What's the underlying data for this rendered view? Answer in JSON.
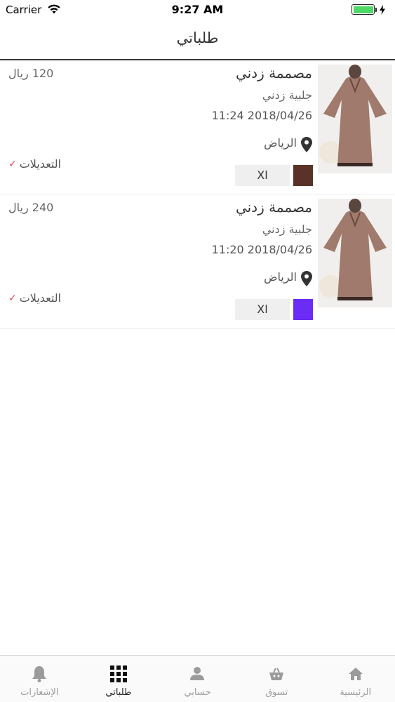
{
  "status_bar": {
    "carrier": "Carrier",
    "time": "9:27 AM",
    "battery_color": "#4cd964"
  },
  "nav": {
    "title": "طلباتي"
  },
  "orders": [
    {
      "name": "مصممة زدني",
      "type": "جلبية زدني",
      "date": "11:24 2018/04/26",
      "city": "الرياض",
      "price": "120 ريال",
      "edits_label": "التعديلات",
      "check_icon": "✓",
      "size": "Xl",
      "color": "#5a3328"
    },
    {
      "name": "مصممة زدني",
      "type": "جلبية زدني",
      "date": "11:20 2018/04/26",
      "city": "الرياض",
      "price": "240 ريال",
      "edits_label": "التعديلات",
      "check_icon": "✓",
      "size": "Xl",
      "color": "#6b2cf5"
    }
  ],
  "tabs": [
    {
      "label": "الإشعارات",
      "icon": "bell-icon",
      "active": false
    },
    {
      "label": "طلباتي",
      "icon": "grid-icon",
      "active": true
    },
    {
      "label": "حسابي",
      "icon": "person-icon",
      "active": false
    },
    {
      "label": "تسوق",
      "icon": "basket-icon",
      "active": false
    },
    {
      "label": "الرئيسية",
      "icon": "home-icon",
      "active": false
    }
  ],
  "colors": {
    "accent_check": "#e0445d",
    "tab_inactive": "#9b9b9b",
    "tab_active": "#222222"
  }
}
